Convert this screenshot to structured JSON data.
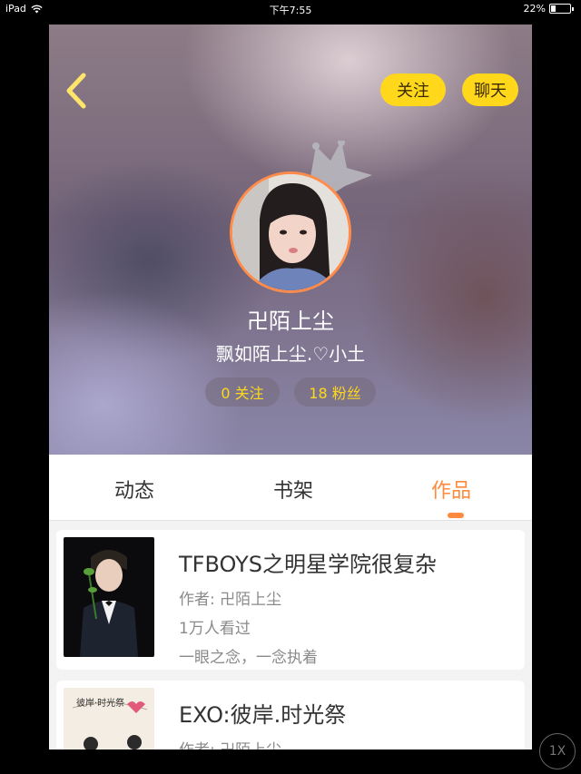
{
  "status_bar": {
    "device": "iPad",
    "time": "下午7:55",
    "battery": "22%",
    "battery_level": 0.22
  },
  "header": {
    "back_icon": "chevron-left-icon",
    "follow_label": "关注",
    "chat_label": "聊天",
    "username": "卍陌上尘",
    "signature": "飘如陌上尘.♡小土",
    "following_stat": "0 关注",
    "fans_stat": "18 粉丝"
  },
  "tabs": [
    {
      "label": "动态",
      "active": false
    },
    {
      "label": "书架",
      "active": false
    },
    {
      "label": "作品",
      "active": true
    }
  ],
  "works": [
    {
      "title": "TFBOYS之明星学院很复杂",
      "author": "作者: 卍陌上尘",
      "views": "1万人看过",
      "description": "一眼之念，一念执着"
    },
    {
      "title": "EXO:彼岸.时光祭",
      "author": "作者: 卍陌上尘",
      "cover_text": "彼岸·时光祭"
    }
  ],
  "zoom_button": "1X",
  "colors": {
    "accent_orange": "#ff8a3d",
    "button_yellow": "#ffd81c"
  }
}
